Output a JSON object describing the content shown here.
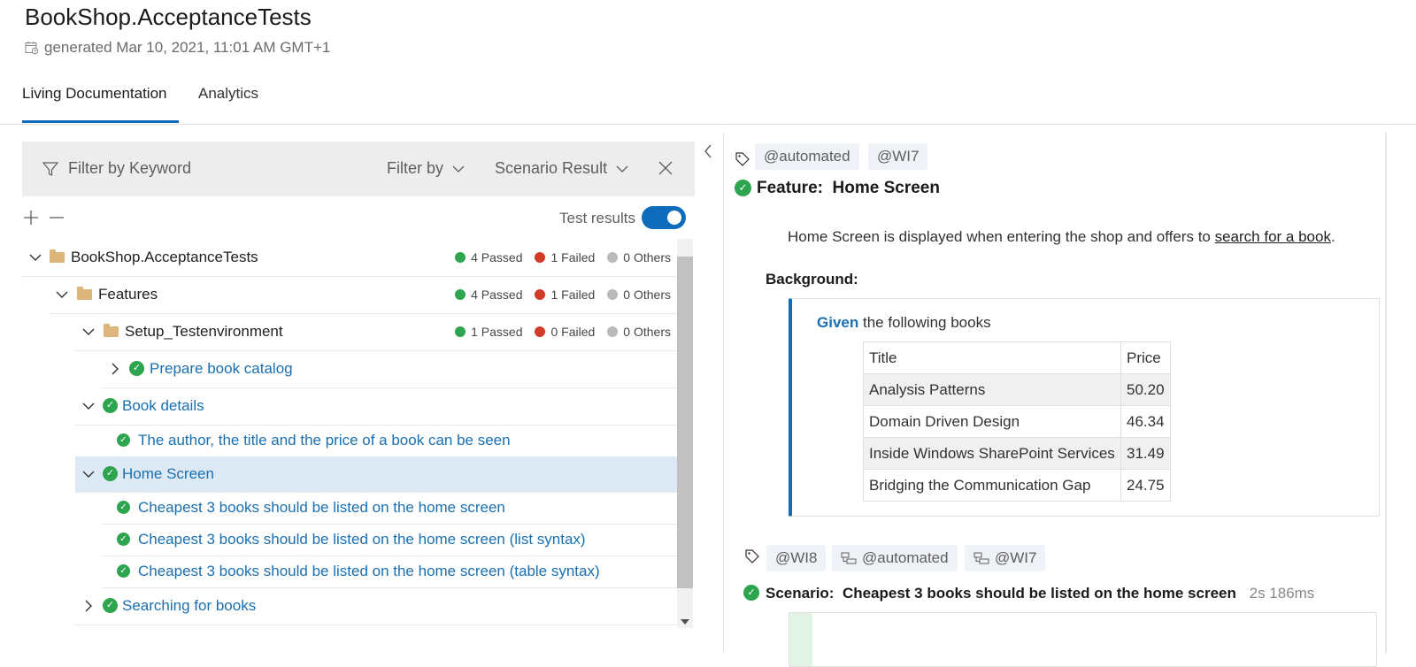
{
  "header": {
    "title": "BookShop.AcceptanceTests",
    "generated": "generated Mar 10, 2021, 11:01 AM GMT+1"
  },
  "tabs": [
    {
      "label": "Living Documentation",
      "active": true
    },
    {
      "label": "Analytics",
      "active": false
    }
  ],
  "filter": {
    "keyword_placeholder": "Filter by Keyword",
    "filter_by": "Filter by",
    "scenario_result": "Scenario Result"
  },
  "tree_tools": {
    "test_results_label": "Test results",
    "test_results_on": true
  },
  "tree": {
    "rows": [
      {
        "label": "BookShop.AcceptanceTests",
        "passed": "4 Passed",
        "failed": "1 Failed",
        "others": "0 Others"
      },
      {
        "label": "Features",
        "passed": "4 Passed",
        "failed": "1 Failed",
        "others": "0 Others"
      },
      {
        "label": "Setup_Testenvironment",
        "passed": "1 Passed",
        "failed": "0 Failed",
        "others": "0 Others"
      },
      {
        "label": "Prepare book catalog"
      },
      {
        "label": "Book details"
      },
      {
        "label": "The author, the title and the price of a book can be seen"
      },
      {
        "label": "Home Screen"
      },
      {
        "label": "Cheapest 3 books should be listed on the home screen"
      },
      {
        "label": "Cheapest 3 books should be listed on the home screen (list syntax)"
      },
      {
        "label": "Cheapest 3 books should be listed on the home screen (table syntax)"
      },
      {
        "label": "Searching for books"
      }
    ]
  },
  "feature": {
    "tags": [
      "@automated",
      "@WI7"
    ],
    "keyword": "Feature:",
    "name": "Home Screen",
    "description_pre": "Home Screen is displayed when entering the shop and offers to ",
    "description_link": "search for a book",
    "description_post": ".",
    "background_label": "Background:",
    "step_keyword": "Given",
    "step_text": " the following books",
    "table": {
      "header": [
        "Title",
        "Price"
      ],
      "rows": [
        [
          "Analysis Patterns",
          "50.20"
        ],
        [
          "Domain Driven Design",
          "46.34"
        ],
        [
          "Inside Windows SharePoint Services",
          "31.49"
        ],
        [
          "Bridging the Communication Gap",
          "24.75"
        ]
      ]
    }
  },
  "scenario": {
    "tags": [
      "@WI8",
      "@automated",
      "@WI7"
    ],
    "keyword": "Scenario:",
    "name": "Cheapest 3 books should be listed on the home screen",
    "duration": "2s 186ms"
  },
  "colors": {
    "accent": "#0f6cbd",
    "passed": "#2da44e",
    "failed": "#d13b2a",
    "others": "#b9b9b9",
    "link": "#1a6fb0"
  }
}
